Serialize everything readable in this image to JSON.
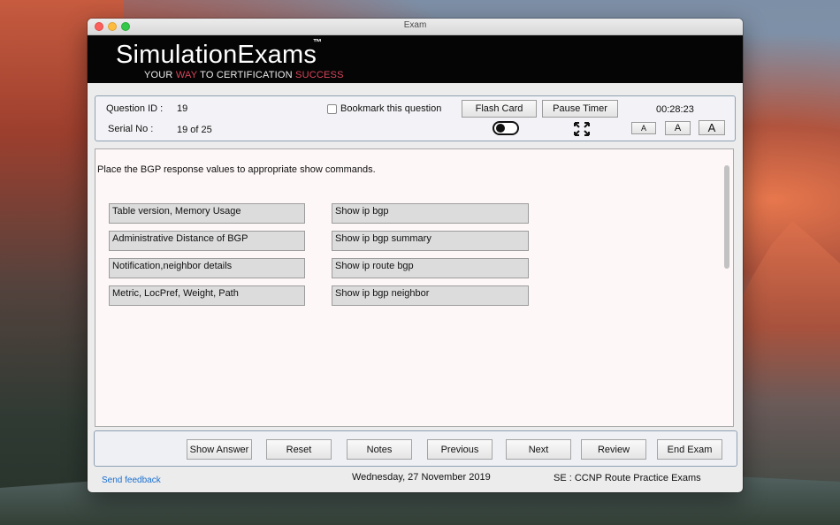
{
  "window": {
    "title": "Exam"
  },
  "brand": {
    "name": "SimulationExams",
    "tm": "™",
    "tagline": [
      {
        "text": "YOUR ",
        "accent": false
      },
      {
        "text": "WAY",
        "accent": true
      },
      {
        "text": " TO CERTIFICATION ",
        "accent": false
      },
      {
        "text": "SUCCESS",
        "accent": true
      }
    ]
  },
  "info": {
    "question_id_label": "Question ID :",
    "question_id": "19",
    "serial_label": "Serial No :",
    "serial_value": "19 of 25",
    "bookmark_label": "Bookmark this question",
    "bookmark_checked": false,
    "flash_card": "Flash Card",
    "pause_timer": "Pause Timer",
    "timer": "00:28:23",
    "font_small": "A",
    "font_medium": "A",
    "font_large": "A"
  },
  "question": {
    "text": "Place the BGP response values to appropriate show commands.",
    "left_items": [
      "Table version, Memory Usage",
      "Administrative Distance of BGP",
      "Notification,neighbor details",
      "Metric, LocPref, Weight, Path"
    ],
    "right_items": [
      "Show  ip bgp",
      "Show ip bgp summary",
      "Show ip route bgp",
      "Show ip bgp neighbor"
    ]
  },
  "actions": {
    "show_answer": "Show Answer",
    "reset": "Reset",
    "notes": "Notes",
    "previous": "Previous",
    "next": "Next",
    "review": "Review",
    "end_exam": "End Exam"
  },
  "footer": {
    "feedback": "Send feedback",
    "date": "Wednesday, 27 November 2019",
    "exam": "SE : CCNP Route Practice Exams"
  },
  "colors": {
    "accent_red": "#d9455b",
    "link_blue": "#1a6fd1",
    "banner_black": "#050505"
  }
}
